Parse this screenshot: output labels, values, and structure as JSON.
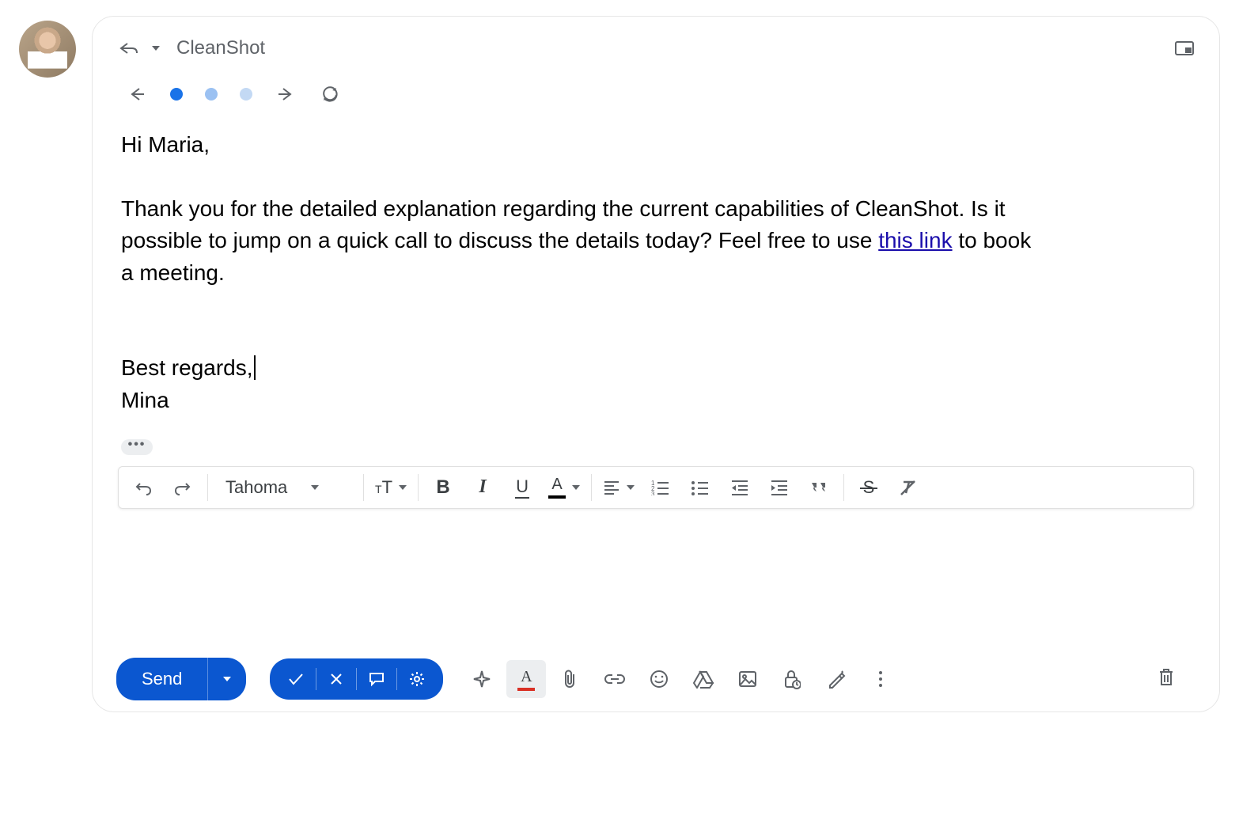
{
  "header": {
    "recipient": "CleanShot"
  },
  "email": {
    "greeting": "Hi Maria,",
    "body_before_link": "Thank you for the detailed explanation regarding the current capabilities of CleanShot. Is it possible to jump on a quick call to discuss the details today? Feel free to use ",
    "link_text": "this link",
    "body_after_link": " to book a meeting.",
    "closing": "Best regards,",
    "signature": "Mina"
  },
  "format_toolbar": {
    "font": "Tahoma",
    "size_label": "ᴛT",
    "bold": "B",
    "italic": "I",
    "underline": "U",
    "text_color": "A"
  },
  "actions": {
    "send": "Send",
    "text_color": "A"
  }
}
